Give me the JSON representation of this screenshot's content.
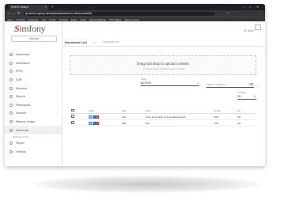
{
  "browser": {
    "tab_title": "SimFon Search",
    "new_tab": "+",
    "window_controls": [
      "–",
      "□",
      "✕"
    ],
    "url": "simfon.myprop.mmfrdpmsuofsoudma.co.uk/documentlist",
    "nav": [
      "←",
      "→",
      "↻"
    ],
    "extensions": [
      "☆",
      "⋮"
    ],
    "bookmarks": [
      "Apps",
      "YouTube",
      "Instagram",
      "V.E.",
      "Gmail",
      "YouTube",
      "Maps",
      "News",
      "Speedy Ratings",
      "NVS Wales",
      "Agency Hours"
    ]
  },
  "sidebar": {
    "logo_prefix": "S",
    "logo_rest": "imfony",
    "company_button": "Marvista",
    "items": [
      {
        "label": "Dashboard",
        "arrow": ""
      },
      {
        "label": "Admissions",
        "arrow": ""
      },
      {
        "label": "PPEs",
        "arrow": "›"
      },
      {
        "label": "SOR",
        "arrow": "›"
      },
      {
        "label": "Windows",
        "arrow": "›"
      },
      {
        "label": "Reports",
        "arrow": "›"
      },
      {
        "label": "Participants",
        "arrow": "›"
      },
      {
        "label": "Invoices",
        "arrow": "›"
      },
      {
        "label": "Balance Ledger",
        "arrow": ""
      },
      {
        "label": "Document",
        "arrow": "⌄"
      }
    ],
    "subitems": [
      "Document List"
    ],
    "items_after": [
      {
        "label": "Report"
      },
      {
        "label": "Settings"
      }
    ]
  },
  "header": {
    "user": "Hi, Kevin",
    "page_title": "Document List",
    "home_icon": "⌂",
    "separator": "›",
    "breadcrumb": "Document List"
  },
  "upload": {
    "title": "Drag and drop to upload content!",
    "subtitle": "...or click to select a file from your computer"
  },
  "filters": {
    "status_label": "Status",
    "status_value": "ACTIVE",
    "search_placeholder": "Type to Search",
    "per_page_label": "Per Page",
    "per_page_value": "10"
  },
  "table": {
    "headers": [
      "",
      "Action",
      "Date",
      "Name",
      "Number",
      "Ext"
    ],
    "rows": [
      {
        "date": "date",
        "name": "lorem ipsum dolor sit amet adipiscing elit",
        "number": "7300",
        "ext": "pdf"
      },
      {
        "date": "date",
        "name": "fred",
        "number": "7700",
        "ext": "pdf"
      }
    ],
    "action_icons": [
      "👁",
      "✎",
      "✕"
    ]
  },
  "colors": {
    "view": "#1e88e5",
    "edit": "#1565c0",
    "delete": "#d32f2f",
    "logo_accent": "#c0392b"
  }
}
